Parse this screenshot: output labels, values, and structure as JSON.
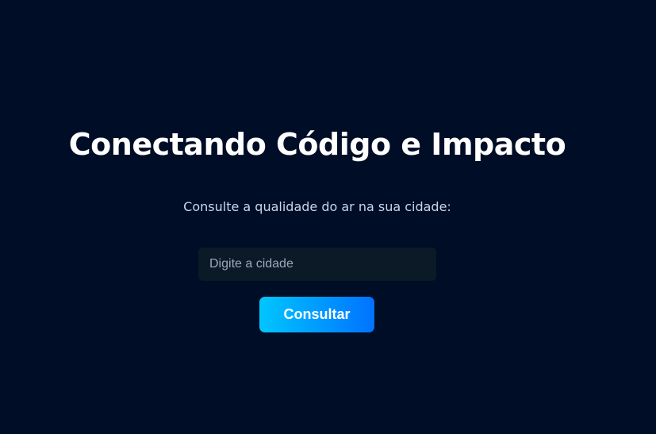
{
  "hero": {
    "title": "Conectando Código e Impacto",
    "subtitle": "Consulte a qualidade do ar na sua cidade:"
  },
  "search": {
    "placeholder": "Digite a cidade",
    "value": "",
    "button_label": "Consultar"
  },
  "colors": {
    "background": "#000d26",
    "input_background": "#0c1a28",
    "button_gradient_start": "#00c6ff",
    "button_gradient_end": "#0072ff",
    "title_text": "#ffffff",
    "subtitle_text": "#c9d6ea"
  }
}
